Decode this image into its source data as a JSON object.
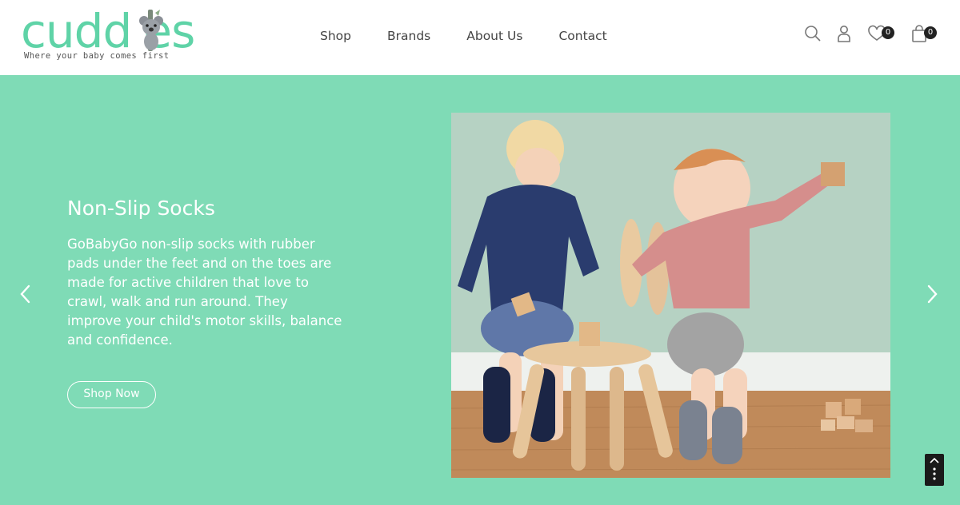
{
  "brand": {
    "logo_text": "cuddles",
    "tagline": "Where your baby comes first",
    "accent_color": "#5fd3a7"
  },
  "nav": {
    "items": [
      "Shop",
      "Brands",
      "About Us",
      "Contact"
    ]
  },
  "header_icons": {
    "search": "search-icon",
    "account": "user-icon",
    "wishlist": "heart-icon",
    "wishlist_count": "0",
    "cart": "bag-icon",
    "cart_count": "0"
  },
  "hero": {
    "background_color": "#7fdbb6",
    "title": "Non-Slip Socks",
    "description": "GoBabyGo non-slip socks with rubber pads under the feet and on the toes are made for active children that love to crawl, walk and run around. They improve your child's motor skills, balance and confidence.",
    "cta_label": "Shop Now",
    "image_alt": "Two toddlers playing with wooden blocks beside a small wooden bunny chair",
    "prev_icon": "chevron-left-icon",
    "next_icon": "chevron-right-icon"
  }
}
